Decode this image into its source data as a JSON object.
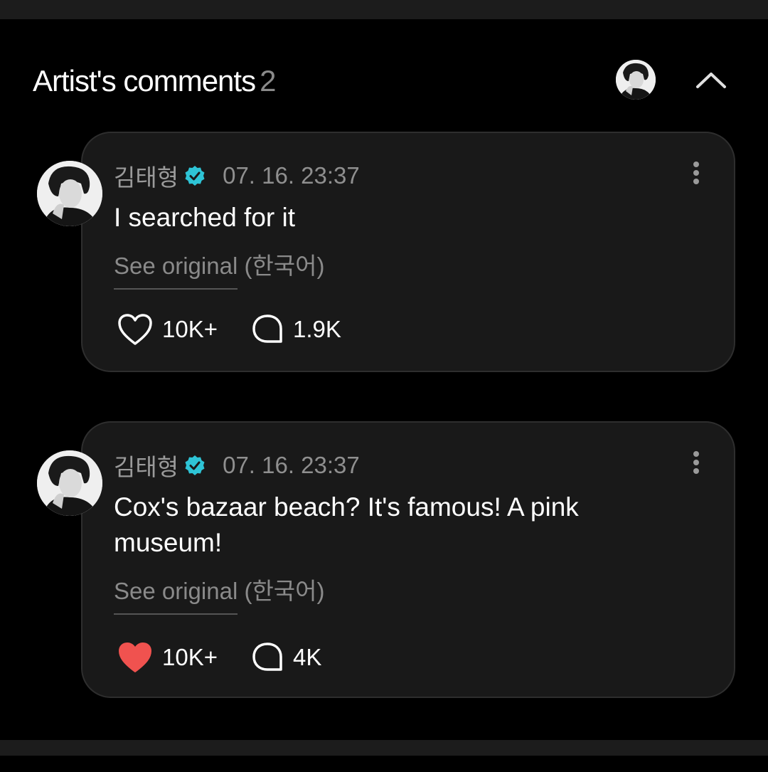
{
  "header": {
    "title": "Artist's comments",
    "count": "2",
    "avatar_icon": "artist-avatar",
    "collapse_icon": "chevron-up-icon"
  },
  "comments": [
    {
      "author": "김태형",
      "verified_color": "#2ec4d6",
      "timestamp": "07. 16. 23:37",
      "text": "I searched for it",
      "see_original": "See original",
      "original_language": "(한국어)",
      "likes": "10K+",
      "liked": false,
      "replies": "1.9K"
    },
    {
      "author": "김태형",
      "verified_color": "#2ec4d6",
      "timestamp": "07. 16. 23:37",
      "text": "Cox's bazaar beach? It's famous! A pink museum!",
      "see_original": "See original",
      "original_language": "(한국어)",
      "likes": "10K+",
      "liked": true,
      "replies": "4K"
    }
  ],
  "colors": {
    "like_active": "#f0524f",
    "background": "#000000",
    "card": "#191919"
  }
}
